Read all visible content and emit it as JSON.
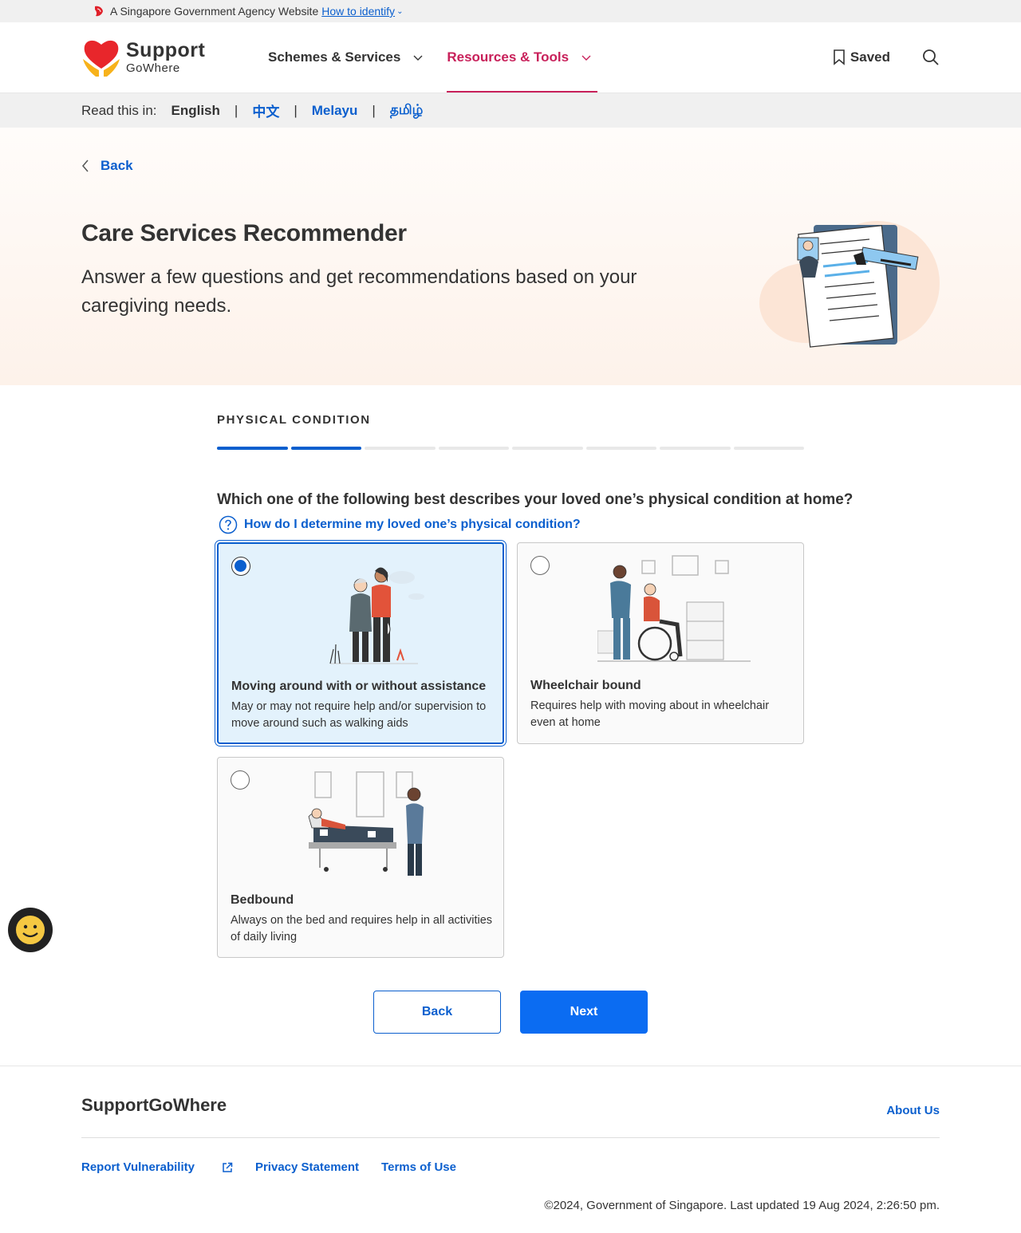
{
  "masthead": {
    "text": "A Singapore Government Agency Website",
    "link": "How to identify"
  },
  "header": {
    "logo_line1": "Support",
    "logo_line2": "GoWhere",
    "nav": [
      {
        "label": "Schemes & Services",
        "active": false
      },
      {
        "label": "Resources & Tools",
        "active": true
      }
    ],
    "saved_label": "Saved"
  },
  "language_bar": {
    "label": "Read this in:",
    "languages": [
      "English",
      "中文",
      "Melayu",
      "தமிழ்"
    ],
    "current": "English"
  },
  "hero": {
    "back_label": "Back",
    "title": "Care Services Recommender",
    "subtitle": "Answer a few questions and get recommendations based on your caregiving needs."
  },
  "form": {
    "step_title": "PHYSICAL CONDITION",
    "progress": {
      "completed": 2,
      "total": 8
    },
    "question": "Which one of the following best describes your loved one’s physical condition at home?",
    "help_link": "How do I determine my loved one’s physical condition?",
    "options": [
      {
        "title": "Moving around with or without assistance",
        "description": "May or may not require help and/or supervision to move around such as walking aids",
        "selected": true
      },
      {
        "title": "Wheelchair bound",
        "description": "Requires help with moving about in wheelchair even at home",
        "selected": false
      },
      {
        "title": "Bedbound",
        "description": "Always on the bed and requires help in all activities of daily living",
        "selected": false
      }
    ],
    "back_button": "Back",
    "next_button": "Next"
  },
  "footer": {
    "brand": "SupportGoWhere",
    "about": "About Us",
    "links": [
      "Report Vulnerability",
      "Privacy Statement",
      "Terms of Use"
    ],
    "copyright": "©2024, Government of Singapore. Last updated 19 Aug 2024, 2:26:50 pm."
  },
  "colors": {
    "primary": "#0b5fce",
    "accent": "#c8205a",
    "selected_bg": "#e3f2fc"
  }
}
